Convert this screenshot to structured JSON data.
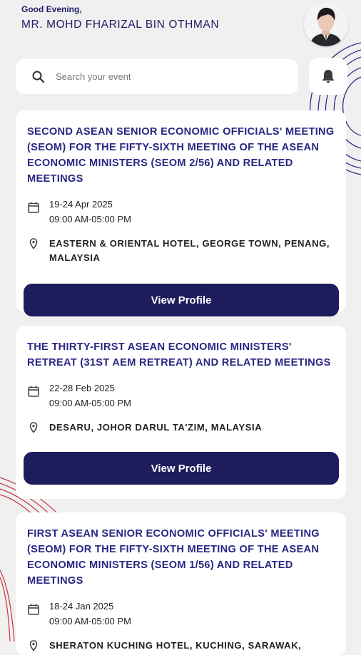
{
  "header": {
    "greeting": "Good Evening,",
    "user_name": "MR. MOHD FHARIZAL BIN OTHMAN"
  },
  "search": {
    "placeholder": "Search your event",
    "value": ""
  },
  "icons": {
    "search": "search-icon",
    "bell": "bell-icon",
    "calendar": "calendar-icon",
    "location": "location-pin-icon"
  },
  "colors": {
    "primary": "#1f1c5e",
    "title": "#2a2684",
    "background": "#f0f0f1",
    "decoration": "#2a2f80",
    "decoration_red": "#c7333f"
  },
  "events": [
    {
      "title": "SECOND ASEAN SENIOR ECONOMIC OFFICIALS' MEETING (SEOM) FOR THE FIFTY-SIXTH MEETING OF THE ASEAN ECONOMIC MINISTERS (SEOM 2/56) AND RELATED MEETINGS",
      "date": "19-24 Apr 2025",
      "time": "09:00 AM-05:00 PM",
      "venue": "EASTERN & ORIENTAL HOTEL, GEORGE TOWN, PENANG, MALAYSIA",
      "button_label": "View Profile"
    },
    {
      "title": "THE THIRTY-FIRST ASEAN ECONOMIC MINISTERS' RETREAT (31ST AEM RETREAT) AND RELATED MEETINGS",
      "date": "22-28 Feb 2025",
      "time": "09:00 AM-05:00 PM",
      "venue": "DESARU, JOHOR DARUL TA'ZIM, MALAYSIA",
      "button_label": "View Profile"
    },
    {
      "title": "FIRST ASEAN SENIOR ECONOMIC OFFICIALS' MEETING (SEOM) FOR THE FIFTY-SIXTH MEETING OF THE ASEAN ECONOMIC MINISTERS (SEOM 1/56) AND RELATED MEETINGS",
      "date": "18-24 Jan 2025",
      "time": "09:00 AM-05:00 PM",
      "venue": "SHERATON KUCHING HOTEL, KUCHING, SARAWAK,",
      "button_label": "View Profile"
    }
  ]
}
